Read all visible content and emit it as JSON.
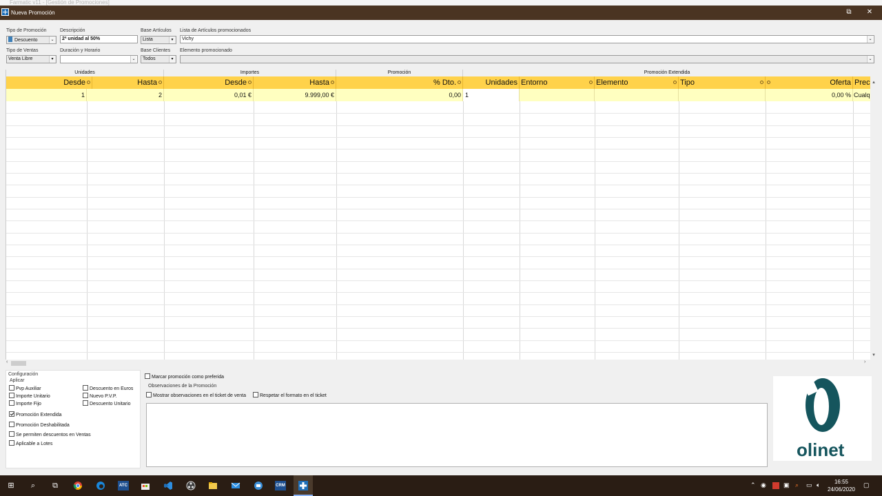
{
  "ghost_title": "Farmatic v11 - [Gestión de Promociones]",
  "window": {
    "title": "Nueva Promoción",
    "restore_glyph": "⧉",
    "close_glyph": "✕"
  },
  "form": {
    "tipo_promocion": {
      "label": "Tipo de Promoción",
      "value": "Descuento"
    },
    "descripcion": {
      "label": "Descripción",
      "value": "2ª unidad al 50%"
    },
    "base_articulos": {
      "label": "Base Artículos",
      "value": "Lista"
    },
    "lista_articulos": {
      "label": "Lista de Artículos promocionados",
      "value": "Vichy"
    },
    "tipo_ventas": {
      "label": "Tipo de Ventas",
      "value": "Venta Libre"
    },
    "duracion_horario": {
      "label": "Duración y Horario",
      "value": ""
    },
    "base_clientes": {
      "label": "Base Clientes",
      "value": "Todos"
    },
    "elemento_promocionado": {
      "label": "Elemento promocionado",
      "value": ""
    }
  },
  "grid": {
    "groups": [
      "Unidades",
      "Importes",
      "Promoción",
      "Promoción Extendida"
    ],
    "columns": [
      "Desde",
      "Hasta",
      "Desde",
      "Hasta",
      "% Dto.",
      "Unidades",
      "Entorno",
      "Elemento",
      "Tipo",
      "Oferta",
      "Precio"
    ],
    "rows": [
      [
        "1",
        "2",
        "0,01 €",
        "9.999,00 €",
        "0,00",
        "1",
        "",
        "",
        "",
        "0,00 %",
        "Cualquiera"
      ]
    ]
  },
  "config": {
    "section_label": "Configuración",
    "apply_label": "Aplicar",
    "pvp_auxiliar": "Pvp Auxiliar",
    "importe_unitario": "Importe Unitario",
    "importe_fijo": "Importe Fijo",
    "descuento_euros": "Descuento en Euros",
    "nuevo_pvp": "Nuevo P.V.P.",
    "descuento_unitario": "Descuento Unitario",
    "promocion_extendida": "Promoción Extendida",
    "promocion_deshabilitada": "Promoción Deshabilitada",
    "se_permiten_descuentos": "Se permiten descuentos en Ventas",
    "aplicable_lotes": "Aplicable a Lotes",
    "promocion_extendida_checked": true
  },
  "observaciones": {
    "marcar_preferida": "Marcar promoción como preferida",
    "section_label": "Observaciones de la Promoción",
    "mostrar_ticket": "Mostrar observaciones en el ticket de venta",
    "respetar_formato": "Respetar el formato en el ticket"
  },
  "logo": {
    "text": "olinet",
    "color": "#15555d"
  },
  "taskbar": {
    "time": "16:55",
    "date": "24/06/2020",
    "atc_label": "ATC",
    "crm_label": "CRM"
  },
  "colors": {
    "header": "#ffd24a",
    "row": "#ffffc0",
    "titlebar": "#4a3422",
    "taskbar": "#2a1d14"
  }
}
